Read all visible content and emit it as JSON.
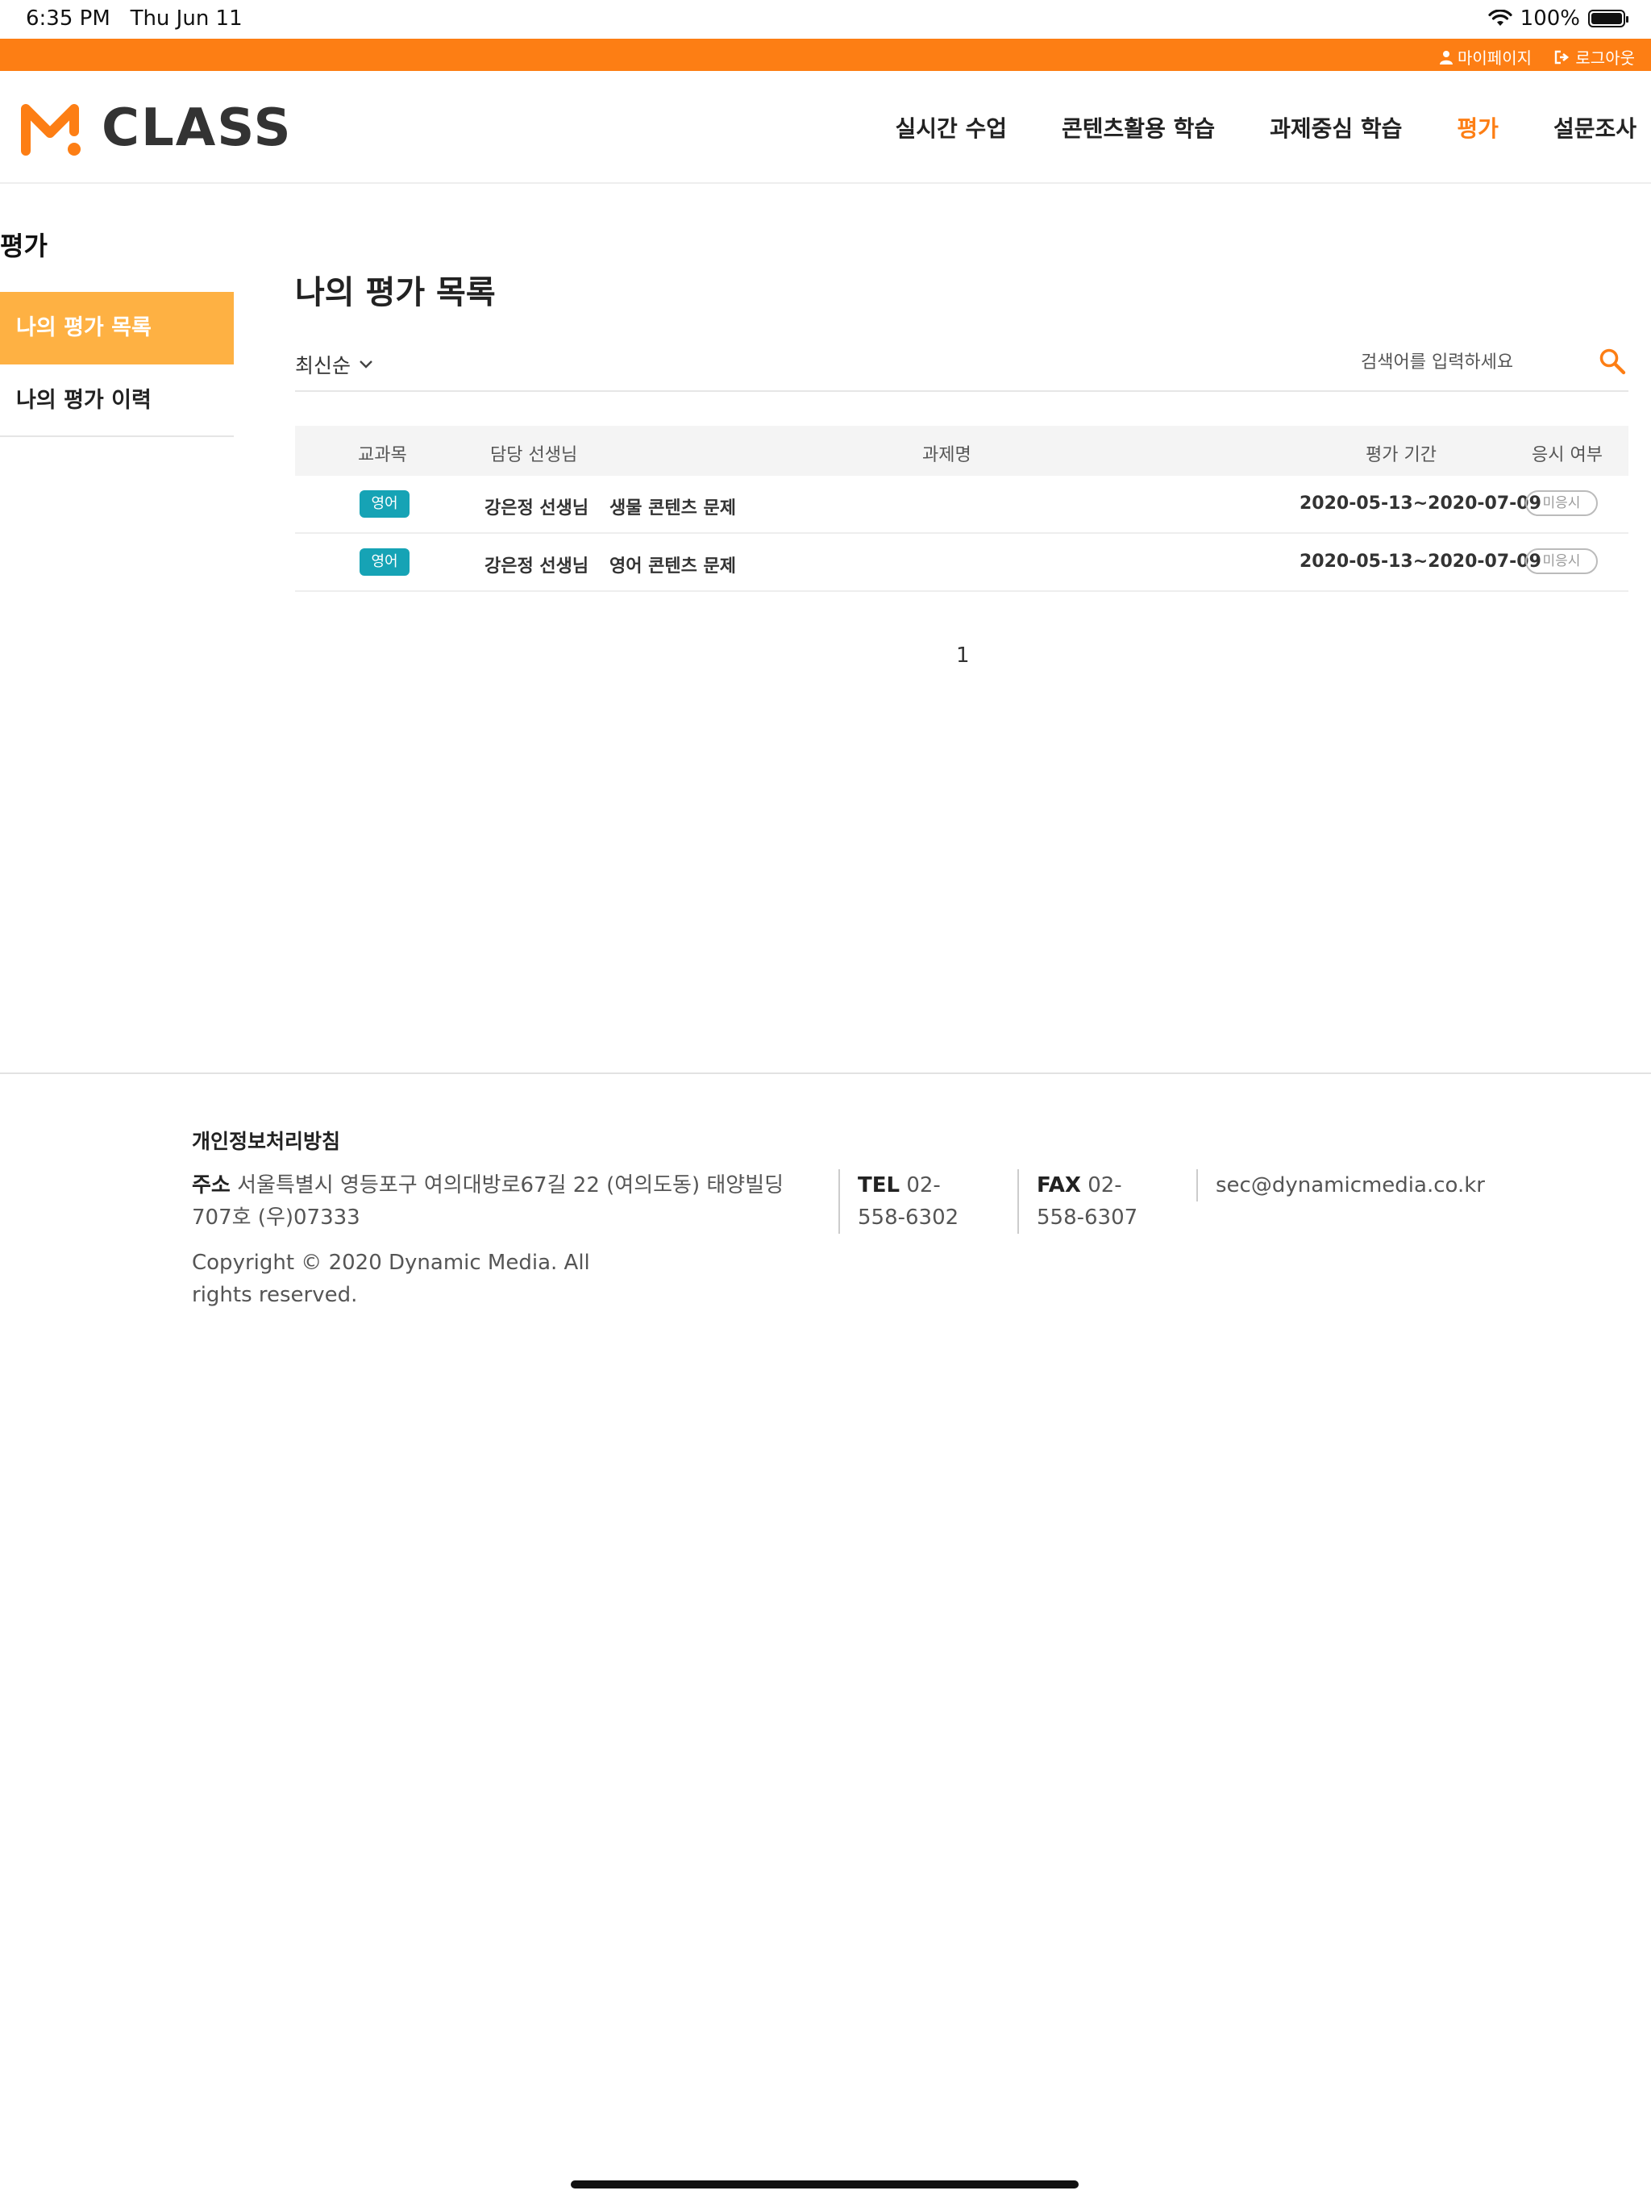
{
  "status_bar": {
    "time": "6:35 PM",
    "date": "Thu Jun 11",
    "battery": "100%"
  },
  "top_util": {
    "mypage": "마이페이지",
    "logout": "로그아웃"
  },
  "logo": {
    "text": "CLASS"
  },
  "nav": [
    {
      "label": "실시간 수업",
      "active": false
    },
    {
      "label": "콘텐츠활용 학습",
      "active": false
    },
    {
      "label": "과제중심 학습",
      "active": false
    },
    {
      "label": "평가",
      "active": true
    },
    {
      "label": "설문조사",
      "active": false
    }
  ],
  "sidebar": {
    "title": "평가",
    "items": [
      {
        "label": "나의 평가 목록",
        "active": true
      },
      {
        "label": "나의 평가 이력",
        "active": false
      }
    ]
  },
  "main": {
    "title": "나의 평가 목록",
    "sort_label": "최신순",
    "search_placeholder": "검색어를 입력하세요"
  },
  "table": {
    "headers": {
      "subject": "교과목",
      "teacher": "담당 선생님",
      "assignment": "과제명",
      "period": "평가 기간",
      "status": "응시 여부"
    },
    "rows": [
      {
        "subject": "영어",
        "teacher": "강은정 선생님",
        "assignment": "생물 콘텐츠 문제",
        "period": "2020-05-13~2020-07-09",
        "status": "미응시"
      },
      {
        "subject": "영어",
        "teacher": "강은정 선생님",
        "assignment": "영어 콘텐츠 문제",
        "period": "2020-05-13~2020-07-09",
        "status": "미응시"
      }
    ]
  },
  "pagination": {
    "current": "1"
  },
  "footer": {
    "privacy": "개인정보처리방침",
    "address_label": "주소",
    "address": "서울특별시 영등포구 여의대방로67길 22 (여의도동) 태양빌딩 707호 (우)07333",
    "copyright": "Copyright © 2020 Dynamic Media. All rights reserved.",
    "tel_label": "TEL",
    "tel": "02-558-6302",
    "fax_label": "FAX",
    "fax": "02-558-6307",
    "email": "sec@dynamicmedia.co.kr"
  },
  "colors": {
    "brand_orange": "#fd7e14",
    "sidebar_active": "#feb143",
    "subject_badge": "#16a3b5"
  }
}
